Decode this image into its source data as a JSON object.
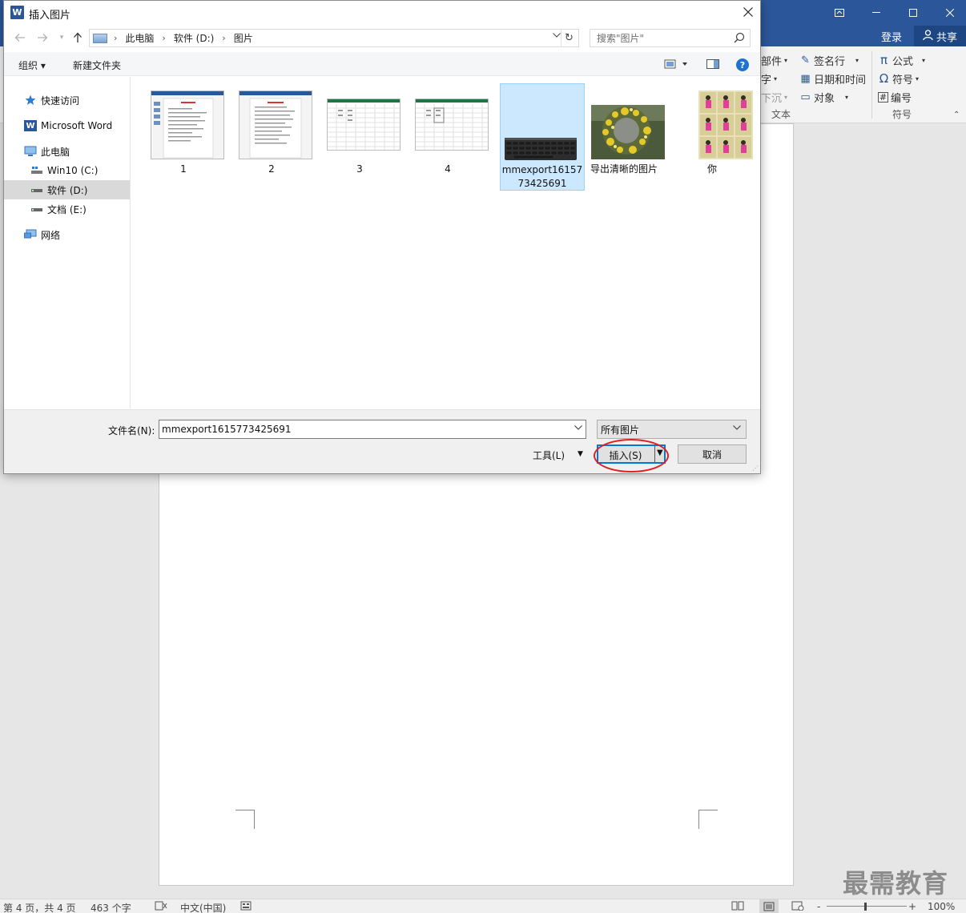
{
  "word": {
    "login": "登录",
    "share": "共享",
    "ribbon": {
      "col1": [
        "部件",
        "字",
        "下沉"
      ],
      "col2": [
        "签名行",
        "日期和时间",
        "对象"
      ],
      "col3": [
        "公式",
        "符号",
        "编号"
      ],
      "group_text": "文本",
      "group_symbol": "符号"
    },
    "status": {
      "page": "第 4 页，共 4 页",
      "words": "463 个字",
      "language": "中文(中国)",
      "zoom_minus": "-",
      "zoom_plus": "+",
      "zoom": "100%"
    },
    "watermark": "最需教育"
  },
  "dialog": {
    "title": "插入图片",
    "breadcrumb": [
      "此电脑",
      "软件 (D:)",
      "图片"
    ],
    "search_placeholder": "搜索\"图片\"",
    "commands": {
      "organize": "组织 ▾",
      "new_folder": "新建文件夹"
    },
    "nav": [
      {
        "label": "快速访问",
        "icon": "star-icon"
      },
      {
        "label": "Microsoft Word",
        "icon": "word-icon"
      },
      {
        "label": "此电脑",
        "icon": "computer-icon"
      },
      {
        "label": "Win10 (C:)",
        "icon": "drive-icon"
      },
      {
        "label": "软件 (D:)",
        "icon": "drive-icon",
        "selected": true
      },
      {
        "label": "文档 (E:)",
        "icon": "drive-icon"
      },
      {
        "label": "网络",
        "icon": "network-icon"
      }
    ],
    "files": [
      {
        "name": "1",
        "kind": "word-doc"
      },
      {
        "name": "2",
        "kind": "word-doc"
      },
      {
        "name": "3",
        "kind": "excel"
      },
      {
        "name": "4",
        "kind": "excel"
      },
      {
        "name": "mmexport1615773425691",
        "kind": "keyboard-photo",
        "selected": true
      },
      {
        "name": "导出清晰的图片",
        "kind": "flower-wreath-photo"
      },
      {
        "name": "你",
        "kind": "portrait-collage"
      }
    ],
    "filename_label": "文件名(N):",
    "filename_value": "mmexport1615773425691",
    "filter_value": "所有图片",
    "tools_label": "工具(L)",
    "insert_label": "插入(S)",
    "cancel_label": "取消",
    "accent_color": "#0078d7",
    "highlight_color": "#e02020"
  }
}
